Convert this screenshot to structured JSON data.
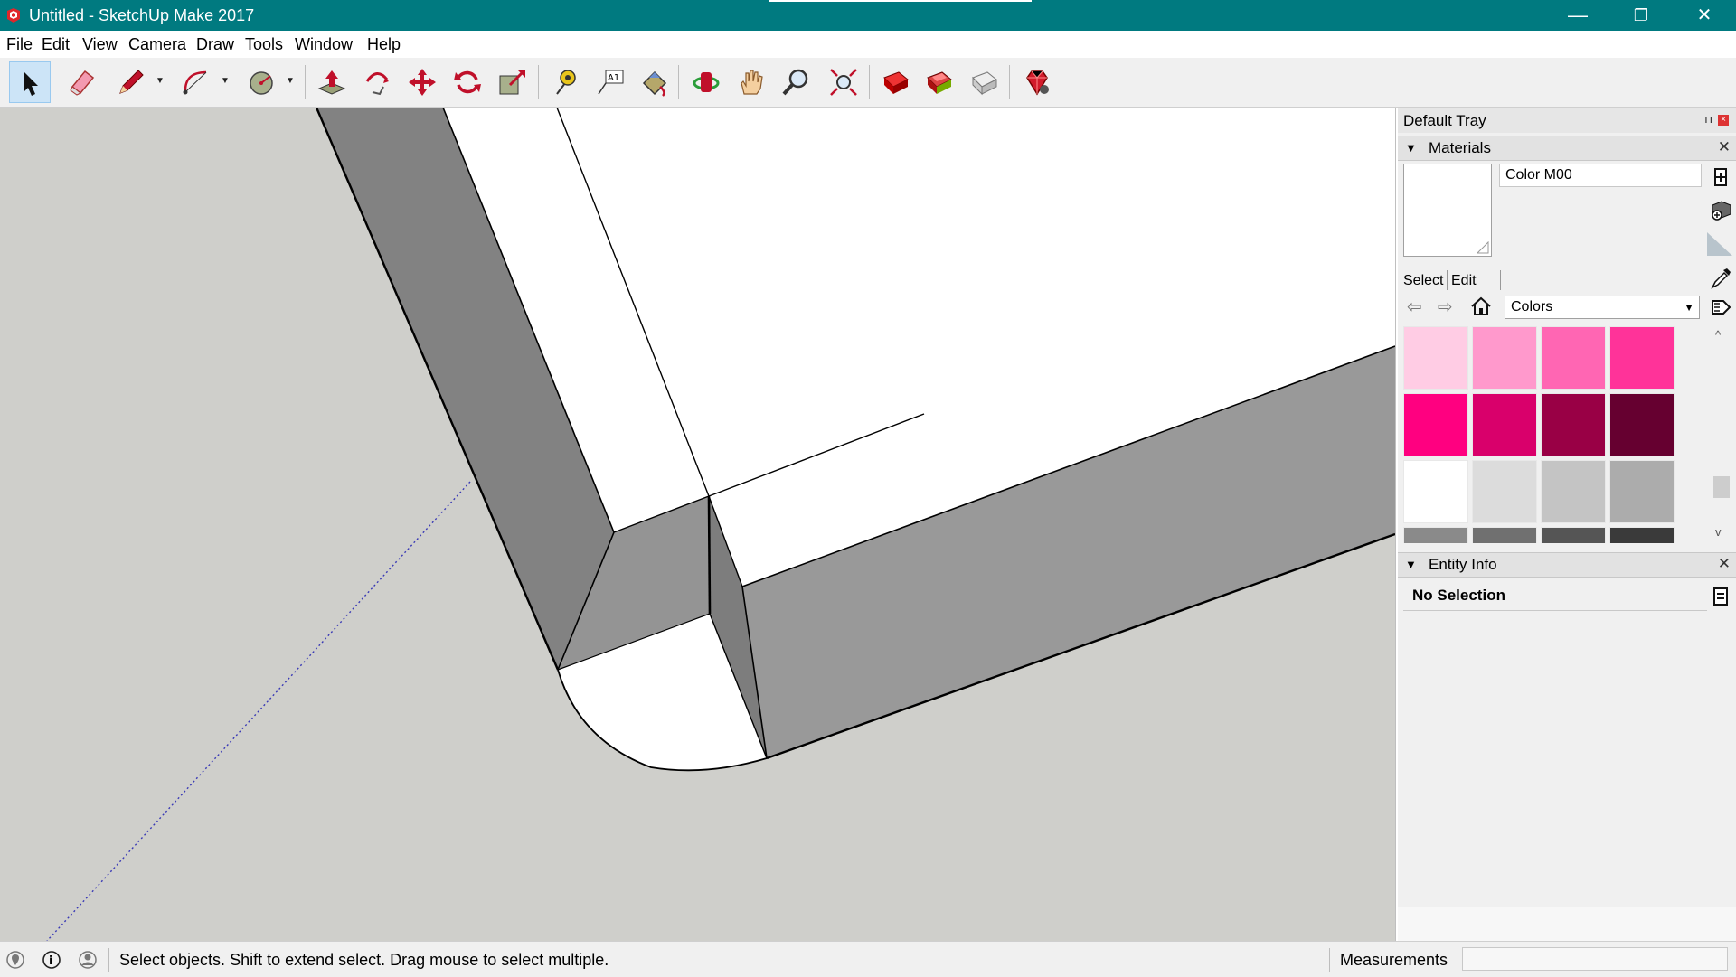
{
  "window": {
    "title": "Untitled - SketchUp Make 2017",
    "icons": {
      "minimize": "minimize-icon",
      "maximize": "restore-icon",
      "close": "close-icon"
    },
    "glyphs": {
      "minimize": "—",
      "maximize": "❐",
      "close": "✕"
    }
  },
  "menu": [
    "File",
    "Edit",
    "View",
    "Camera",
    "Draw",
    "Tools",
    "Window",
    "Help"
  ],
  "toolbar": {
    "tools": [
      "select",
      "eraser",
      "line",
      "arc",
      "shapes",
      "push-pull",
      "follow-me",
      "move",
      "rotate",
      "scale",
      "tape-measure",
      "text",
      "paint-bucket",
      "orbit",
      "pan",
      "zoom",
      "zoom-extents",
      "3d-warehouse",
      "extension-warehouse",
      "layout",
      "extension-manager"
    ],
    "active": "select",
    "text_tool_glyph": "A1"
  },
  "tray": {
    "title": "Default Tray",
    "pin_glyph": "⊓",
    "close_glyph": "×",
    "materials": {
      "header": "Materials",
      "collapse_glyph": "▼",
      "close_glyph": "✕",
      "material_name": "Color M00",
      "tabs": [
        "Select",
        "Edit"
      ],
      "nav": {
        "back": "⇦",
        "forward": "⇨"
      },
      "collection": "Colors",
      "dropdown_glyph": "▼",
      "scroll": {
        "up": "^",
        "down": "v"
      },
      "swatches": [
        [
          "#ffcce4",
          "#ff99cc",
          "#ff66b3",
          "#ff3399"
        ],
        [
          "#ff0080",
          "#d9006b",
          "#990045",
          "#660030"
        ],
        [
          "#ffffff",
          "#dcdcdc",
          "#c4c4c4",
          "#acacac"
        ],
        [
          "#8a8a8a",
          "#707070",
          "#555555",
          "#3a3a3a"
        ]
      ]
    },
    "entity_info": {
      "header": "Entity Info",
      "collapse_glyph": "▼",
      "close_glyph": "✕",
      "selection": "No Selection"
    }
  },
  "status": {
    "message": "Select objects. Shift to extend select. Drag mouse to select multiple.",
    "measurements_label": "Measurements",
    "icons": [
      "geo-location-icon",
      "credits-icon",
      "user-icon"
    ],
    "credits_glyph": "i"
  },
  "colors": {
    "titlebar": "#007a80",
    "viewport_bg": "#cfcfcb",
    "face_dark": "#828282",
    "face_mid": "#999999",
    "face_light": "#ffffff"
  }
}
